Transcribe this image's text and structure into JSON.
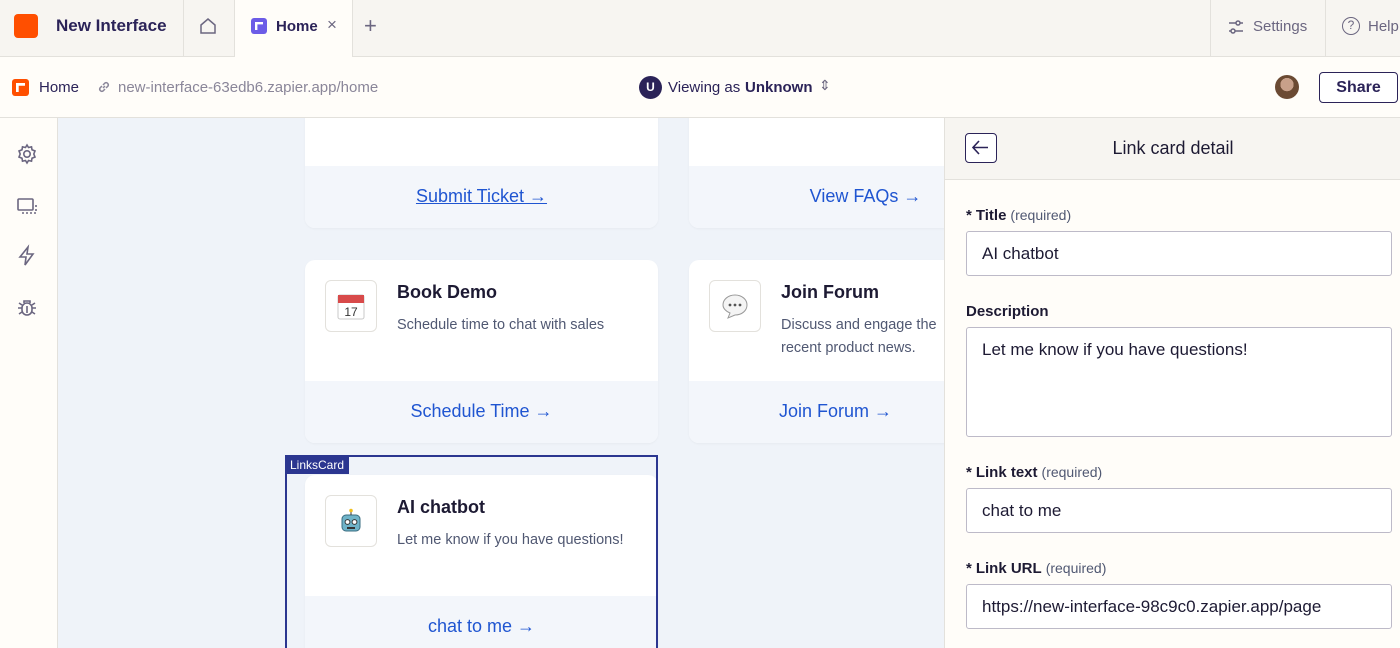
{
  "app": {
    "name": "New Interface",
    "brand_color": "#ff4f00"
  },
  "tabs": [
    {
      "label": "Home",
      "active": true
    }
  ],
  "topbar": {
    "settings_label": "Settings",
    "help_label": "Help",
    "close_symbol": "×",
    "new_tab_symbol": "+"
  },
  "subbar": {
    "page_label": "Home",
    "url": "new-interface-63edb6.zapier.app/home",
    "viewing_prefix": "Viewing as",
    "viewing_user": "Unknown",
    "viewing_avatar_letter": "U",
    "share_label": "Share"
  },
  "rail": {
    "icons": [
      "gear-icon",
      "layout-icon",
      "lightning-icon",
      "bug-icon"
    ]
  },
  "cards": [
    {
      "title": "",
      "description": "",
      "link_text": "Submit Ticket →",
      "underline": true
    },
    {
      "title": "",
      "description": "",
      "link_text": "View FAQs →"
    },
    {
      "title": "Book Demo",
      "description": "Schedule time to chat with sales",
      "link_text": "Schedule Time →",
      "icon": "calendar-icon",
      "icon_number": "17"
    },
    {
      "title": "Join Forum",
      "description": "Discuss and engage the recent product news.",
      "link_text": "Join Forum →",
      "icon": "speech-bubble-icon"
    },
    {
      "title": "AI chatbot",
      "description": "Let me know if you have questions!",
      "link_text": "chat to me →",
      "icon": "robot-icon",
      "selected": true
    }
  ],
  "selection_tag": "LinksCard",
  "panel": {
    "title": "Link card detail",
    "fields": {
      "title": {
        "required_mark": "*",
        "label": "Title",
        "hint": "(required)",
        "value": "AI chatbot"
      },
      "description": {
        "label": "Description",
        "value": "Let me know if you have questions!"
      },
      "link_text": {
        "required_mark": "*",
        "label": "Link text",
        "hint": "(required)",
        "value": "chat to me"
      },
      "link_url": {
        "required_mark": "*",
        "label": "Link URL",
        "hint": "(required)",
        "value": "https://new-interface-98c9c0.zapier.app/page"
      }
    }
  }
}
